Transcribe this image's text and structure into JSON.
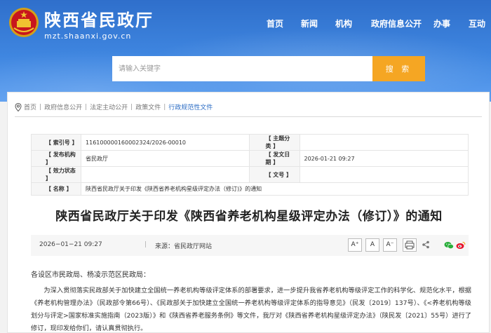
{
  "header": {
    "site_title": "陕西省民政厅",
    "site_domain": "mzt.shaanxi.gov.cn",
    "nav": [
      "首页",
      "新闻",
      "机构",
      "政府信息公开",
      "办事",
      "互动"
    ],
    "search_placeholder": "请输入关键字",
    "search_button": "搜 索"
  },
  "breadcrumb": [
    "首页",
    "政府信息公开",
    "法定主动公开",
    "政策文件",
    "行政规范性文件"
  ],
  "meta": {
    "index_label": "【 索引号 】",
    "index_value": "116100000160002324/2026-00010",
    "theme_label": "【 主题分类 】",
    "theme_value": "",
    "issuer_label": "【 发布机构 】",
    "issuer_value": "省民政厅",
    "date_label": "【 发文日期 】",
    "date_value": "2026-01-21 09:27",
    "status_label": "【 效力状态 】",
    "status_value": "",
    "docno_label": "【 文号 】",
    "docno_value": "",
    "name_label": "【 名称 】",
    "name_value": "陕西省民政厅关于印发《陕西省养老机构星级评定办法（修订)》的通知"
  },
  "article": {
    "title": "陕西省民政厅关于印发《陕西省养老机构星级评定办法（修订）》的通知",
    "date": "2026−01−21 09:27",
    "source_label": "来源：",
    "source": "省民政厅网站",
    "font_large": "A⁺",
    "font_mid": "A",
    "font_small": "A⁻",
    "salutation": "各设区市民政局、杨凌示范区民政局：",
    "paragraph": "为深入贯彻落实民政部关于加快建立全国统一养老机构等级评定体系的部署要求，进一步提升我省养老机构等级评定工作的科学化、规范化水平，根据《养老机构管理办法》（民政部令第66号）、《民政部关于加快建立全国统一养老机构等级评定体系的指导意见》（民发〔2019〕137号）、《<养老机构等级划分与评定>国家标准实施指南（2023版）》和《陕西省养老服务条例》等文件，我厅对《陕西省养老机构星级评定办法》（陕民发〔2021〕55号）进行了修订，现印发给你们，请认真贯彻执行。"
  },
  "colors": {
    "header_blue": "#3a7fd9",
    "search_orange": "#f5a623",
    "breadcrumb_active": "#2b6cc4"
  }
}
